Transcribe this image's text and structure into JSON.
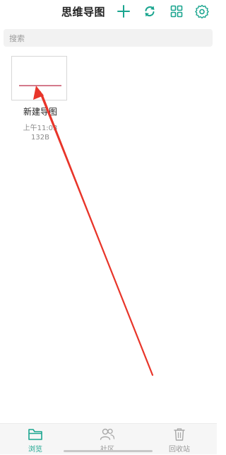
{
  "header": {
    "title": "思维导图",
    "actions": [
      {
        "icon": "plus-icon"
      },
      {
        "icon": "sync-icon"
      },
      {
        "icon": "grid-view-icon"
      },
      {
        "icon": "gear-icon"
      }
    ]
  },
  "search": {
    "placeholder": "搜索"
  },
  "files": [
    {
      "name": "新建导图",
      "time": "上午11:03",
      "size": "132B"
    }
  ],
  "bottom_nav": {
    "items": [
      {
        "label": "浏览",
        "icon": "folder-icon",
        "active": true
      },
      {
        "label": "社区",
        "icon": "community-icon",
        "active": false
      },
      {
        "label": "回收站",
        "icon": "trash-icon",
        "active": false
      }
    ]
  },
  "colors": {
    "accent": "#1aa58f",
    "annotation": "#e8352a",
    "thumb_line": "#d47a8c"
  }
}
